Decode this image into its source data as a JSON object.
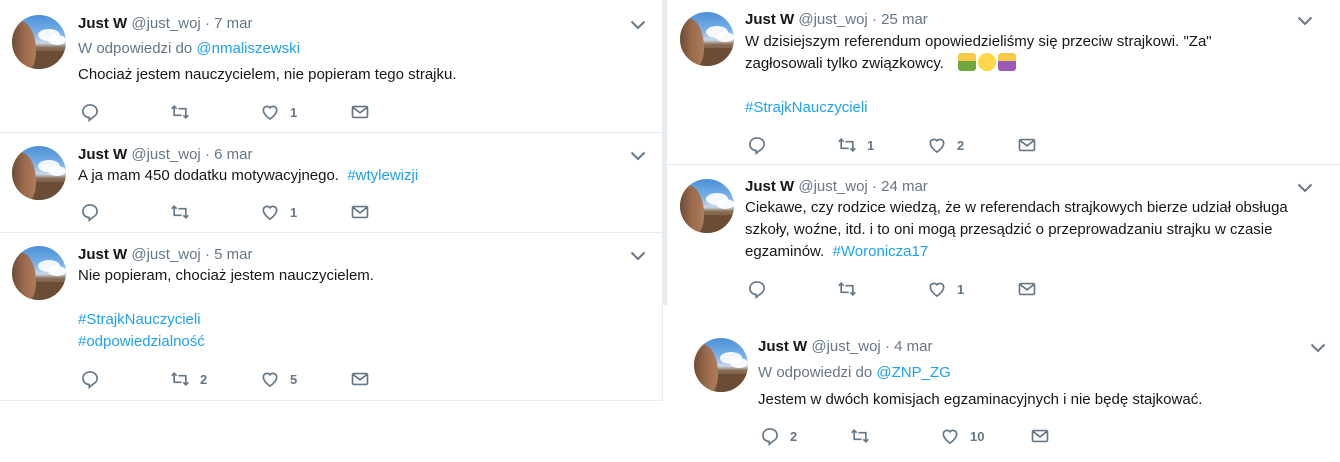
{
  "colors": {
    "link": "#1da1f2",
    "muted": "#657786",
    "text": "#14171a",
    "border": "#e6ecf0"
  },
  "icons": {
    "reply": "reply-icon",
    "retweet": "retweet-icon",
    "like": "heart-icon",
    "dm": "envelope-icon",
    "more": "chevron-down-icon"
  },
  "left_tweets": [
    {
      "name": "Just W",
      "handle": "@just_woj",
      "separator": "·",
      "date": "7 mar",
      "reply_label": "W odpowiedzi do",
      "reply_to": "@nmaliszewski",
      "text": "Chociaż jestem nauczycielem, nie popieram tego strajku.",
      "replies": "",
      "retweets": "",
      "likes": "1"
    },
    {
      "name": "Just W",
      "handle": "@just_woj",
      "separator": "·",
      "date": "6 mar",
      "text": "A ja mam 450 dodatku motywacyjnego.",
      "hashtag": "#wtylewizji",
      "replies": "",
      "retweets": "",
      "likes": "1"
    },
    {
      "name": "Just W",
      "handle": "@just_woj",
      "separator": "·",
      "date": "5 mar",
      "text": "Nie popieram, chociaż jestem nauczycielem.",
      "hashtag1": "#StrajkNauczycieli",
      "hashtag2": "#odpowiedzialność",
      "replies": "",
      "retweets": "2",
      "likes": "5"
    }
  ],
  "right_tweets": [
    {
      "name": "Just W",
      "handle": "@just_woj",
      "separator": "·",
      "date": "25 mar",
      "text_line1": "W dzisiejszym referendum opowiedzieliśmy się przeciw  strajkowi. \"Za\"",
      "text_line2": "zagłosowali tylko związkowcy.",
      "hashtag": "#StrajkNauczycieli",
      "replies": "",
      "retweets": "1",
      "likes": "2"
    },
    {
      "name": "Just W",
      "handle": "@just_woj",
      "separator": "·",
      "date": "24 mar",
      "text_line1": "Ciekawe, czy rodzice wiedzą, że w referendach strajkowych bierze udział obsługa",
      "text_line2": "szkoły, woźne, itd. i to oni mogą przesądzić o przeprowadzaniu strajku w czasie",
      "text_line3": "egzaminów.",
      "hashtag": "#Woronicza17",
      "replies": "",
      "retweets": "",
      "likes": "1"
    },
    {
      "name": "Just W",
      "handle": "@just_woj",
      "separator": "·",
      "date": "4 mar",
      "reply_label": "W odpowiedzi do",
      "reply_to": "@ZNP_ZG",
      "text": "Jestem w dwóch komisjach egzaminacyjnych i nie będę stajkować.",
      "replies": "2",
      "retweets": "",
      "likes": "10"
    }
  ]
}
